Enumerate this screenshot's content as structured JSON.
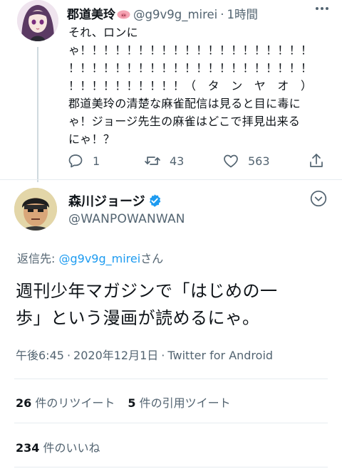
{
  "reply_tweet": {
    "author_name": "郡道美玲",
    "author_handle": "@g9v9g_mirei",
    "time_ago": "1時間",
    "text_lines": [
      "それ、ロンに",
      "ゃ！！！！！！！！！！！！！！！！！！！！",
      "！！！！！！！！！！！！！！！！！！！！！",
      "！！！！！！！！！！（　タ　ン　ヤ　オ　）",
      "郡道美玲の清楚な麻雀配信は見ると目に毒に",
      "ゃ！ジョージ先生の麻雀はどこで拝見出来る",
      "にゃ！？"
    ],
    "reply_count": "1",
    "retweet_count": "43",
    "like_count": "563"
  },
  "main_tweet": {
    "author_name": "森川ジョージ",
    "author_handle": "@WANPOWANWAN",
    "replying_prefix": "返信先: ",
    "replying_to": "@g9v9g_mirei",
    "replying_suffix": "さん",
    "text_lines": [
      "週刊少年マガジンで「はじめの一",
      "歩」という漫画が読めるにゃ。"
    ],
    "time": "午後6:45",
    "date": "2020年12月1日",
    "client": "Twitter for Android",
    "retweets_num": "26",
    "retweets_label": "件のリツイート",
    "quotes_num": "5",
    "quotes_label": "件の引用ツイート",
    "likes_num": "234",
    "likes_label": "件のいいね"
  },
  "colors": {
    "text": "#0f1419",
    "secondary": "#536471",
    "link": "#1d9bf0",
    "divider": "#e6ecf0"
  }
}
